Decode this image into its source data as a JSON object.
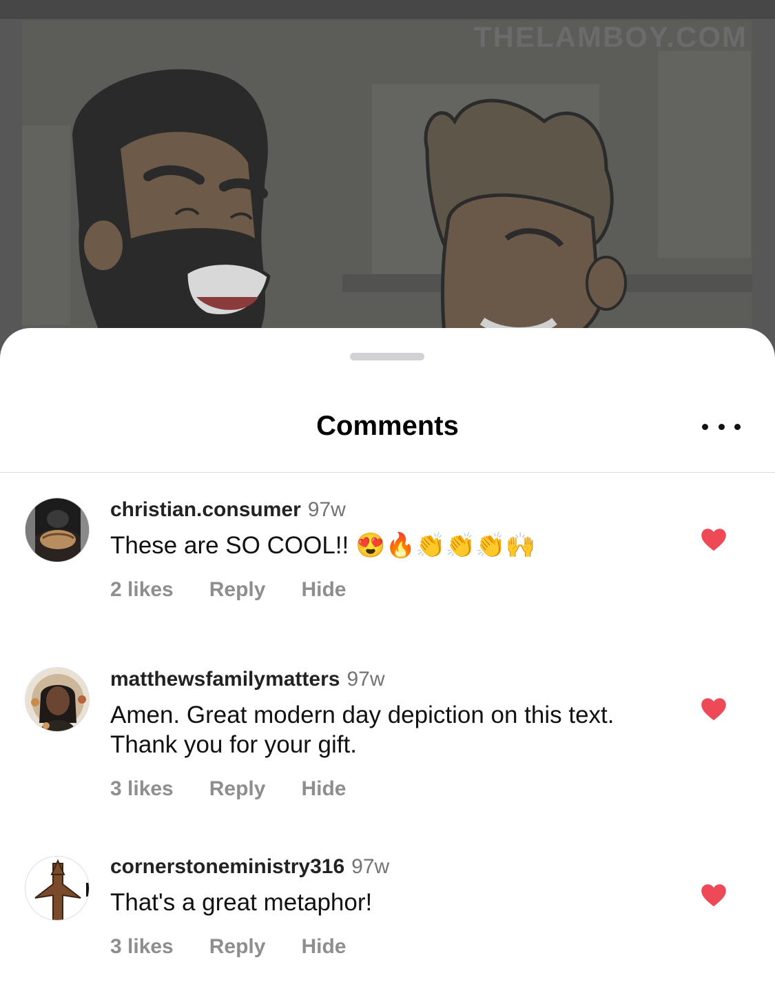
{
  "post": {
    "watermark": "THELAMBOY.COM"
  },
  "sheet": {
    "title": "Comments"
  },
  "comments": [
    {
      "username": "christian.consumer",
      "time": "97w",
      "text": "These are SO COOL!! 😍🔥👏👏👏🙌",
      "likes": "2 likes",
      "reply": "Reply",
      "hide": "Hide",
      "liked": true
    },
    {
      "username": "matthewsfamilymatters",
      "time": "97w",
      "text": "Amen.  Great modern day depiction on this text.  Thank you for your gift.",
      "likes": "3 likes",
      "reply": "Reply",
      "hide": "Hide",
      "liked": true
    },
    {
      "username": "cornerstoneministry316",
      "time": "97w",
      "text": "That's a great metaphor!",
      "likes": "3 likes",
      "reply": "Reply",
      "hide": "Hide",
      "liked": true
    }
  ],
  "colors": {
    "heart": "#ed4956",
    "sheet": "#ffffff",
    "muted": "#8e8e8e"
  },
  "icons": {
    "more": "more-horizontal-icon",
    "heart": "heart-filled-icon"
  }
}
